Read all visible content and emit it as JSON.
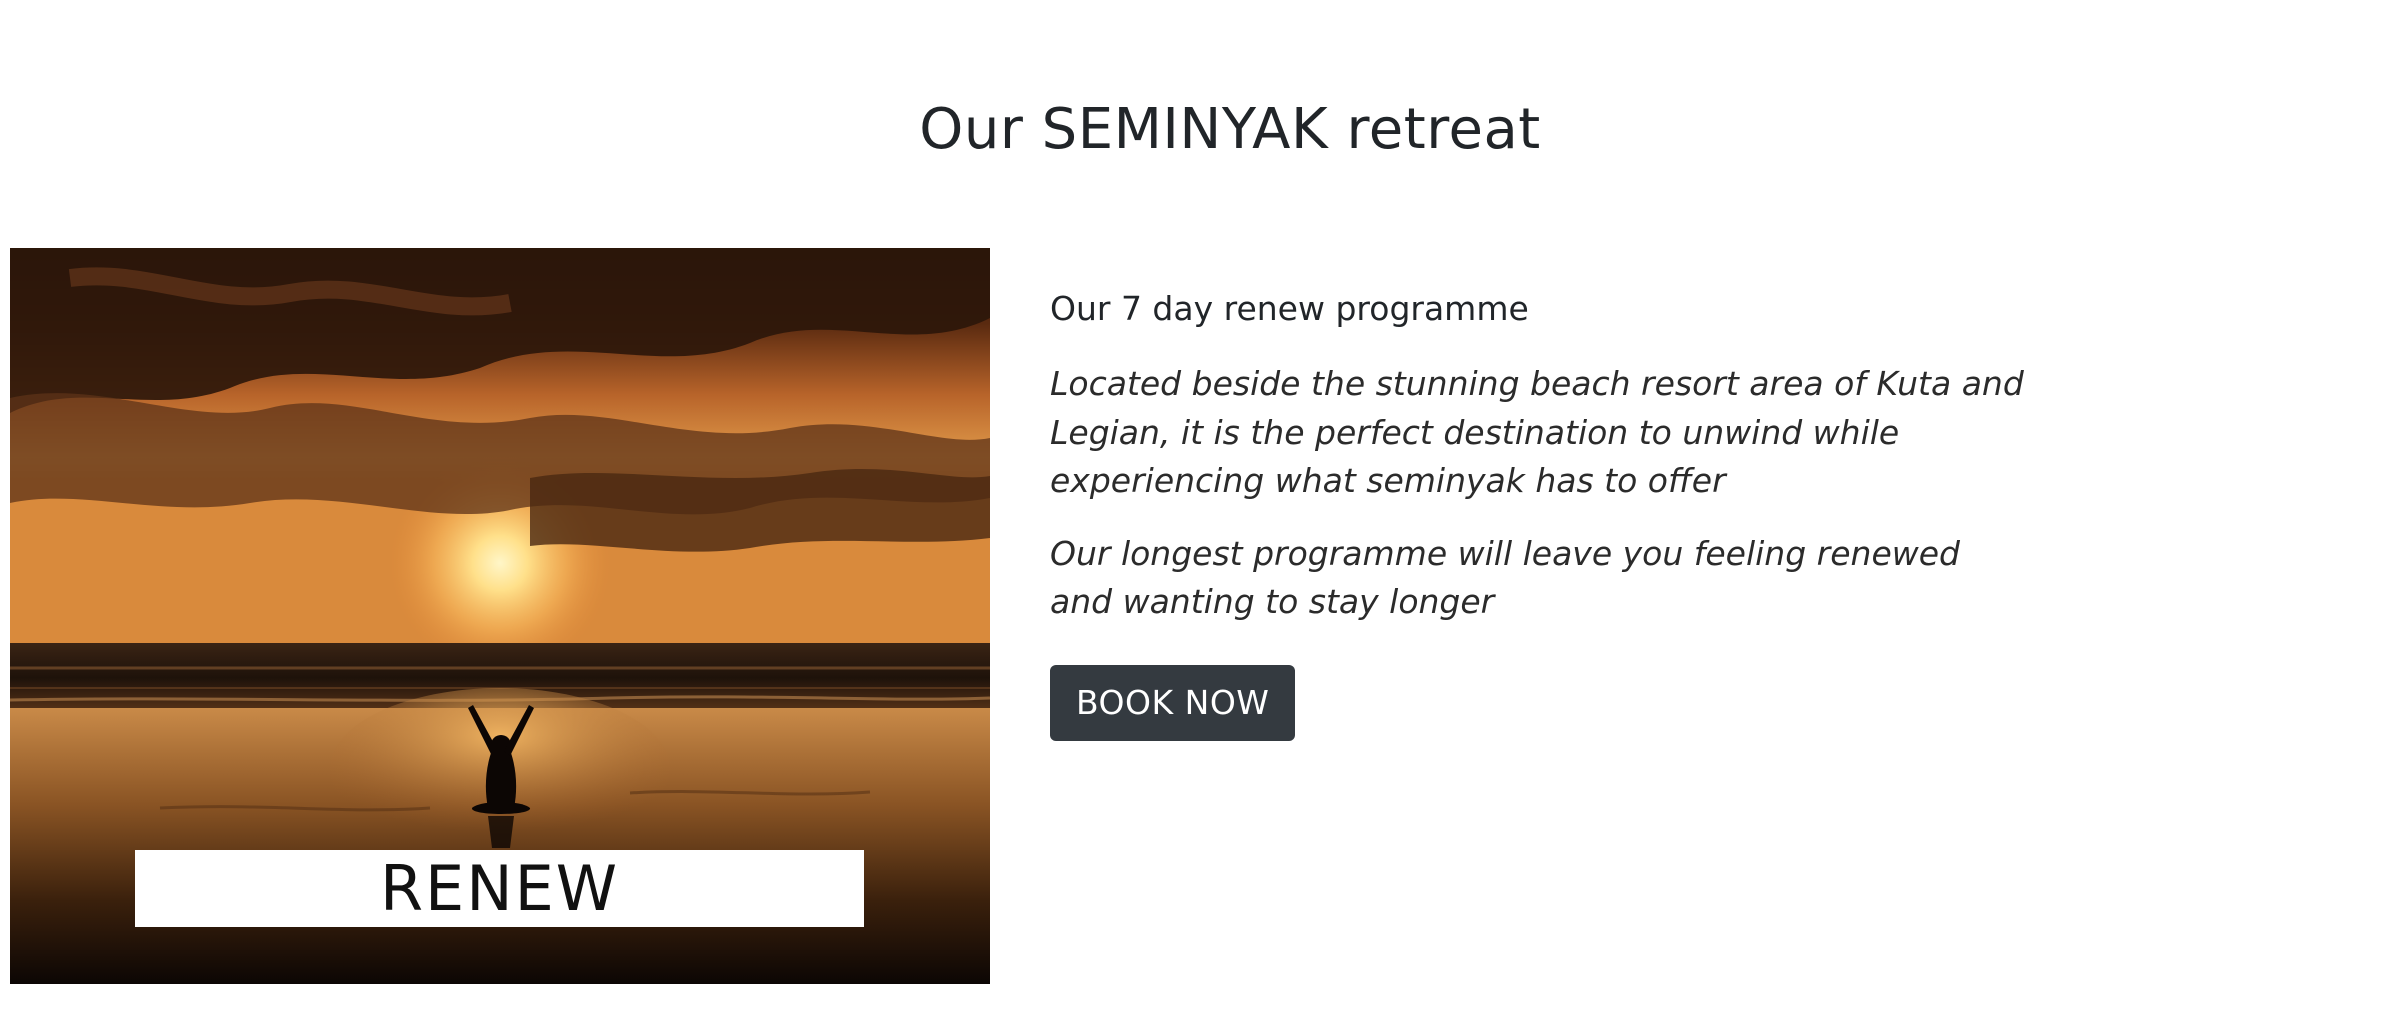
{
  "section": {
    "title": "Our SEMINYAK retreat"
  },
  "image": {
    "overlay_label": "RENEW",
    "subject": "sunset beach yoga silhouette"
  },
  "content": {
    "programme_title": "Our 7 day renew programme",
    "paragraphs": [
      "Located beside the stunning beach resort area of Kuta and Legian, it is the perfect destination to unwind while experiencing what seminyak has to offer",
      "Our longest programme will leave you feeling renewed and wanting to stay longer"
    ],
    "book_button": "BOOK NOW"
  },
  "colors": {
    "button_bg": "#343a40",
    "button_text": "#ffffff",
    "text": "#212529"
  }
}
